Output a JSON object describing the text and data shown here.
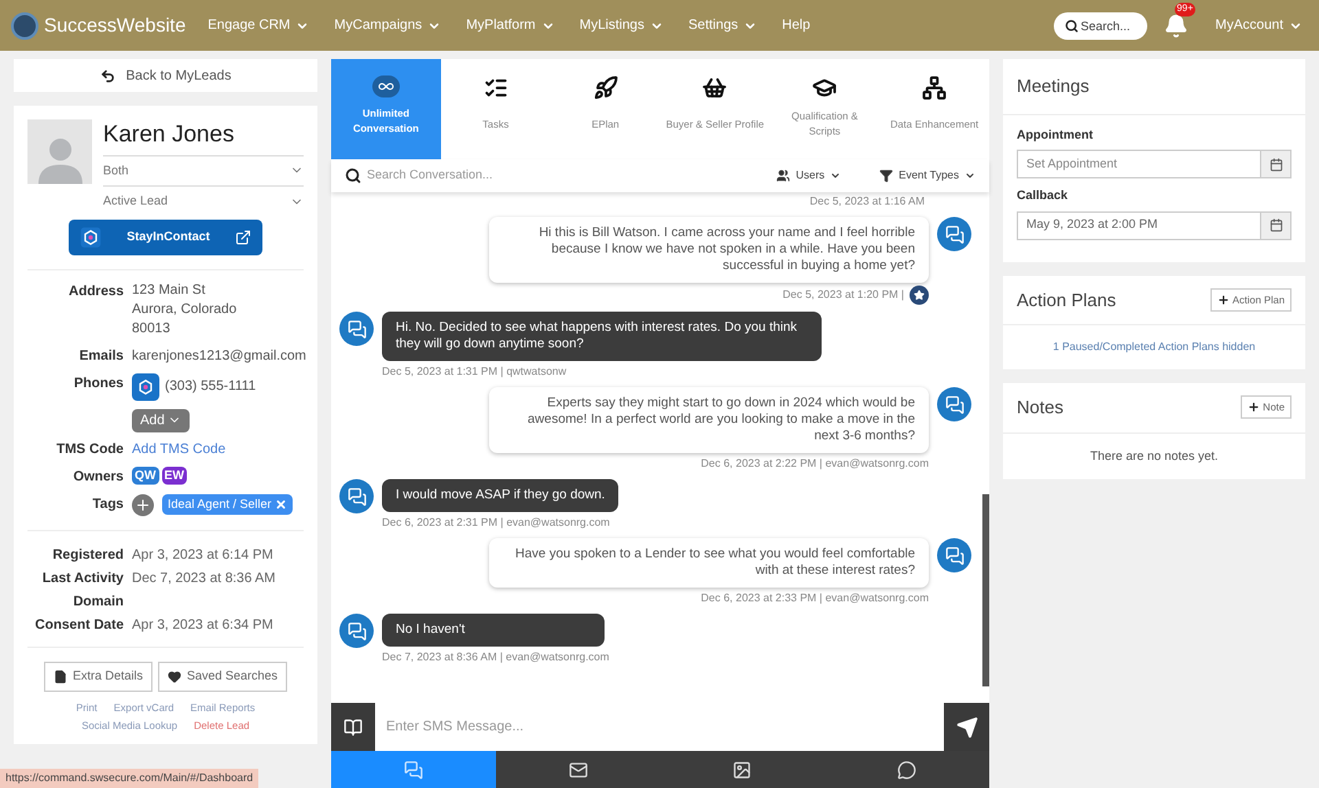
{
  "nav": {
    "brand": "SuccessWebsite",
    "items": [
      {
        "label": "Engage CRM",
        "dropdown": true
      },
      {
        "label": "MyCampaigns",
        "dropdown": true
      },
      {
        "label": "MyPlatform",
        "dropdown": true
      },
      {
        "label": "MyListings",
        "dropdown": true
      },
      {
        "label": "Settings",
        "dropdown": true
      },
      {
        "label": "Help",
        "dropdown": false
      }
    ],
    "search_placeholder": "Search...",
    "notifications_badge": "99+",
    "account": "MyAccount"
  },
  "back_link": "Back to MyLeads",
  "lead": {
    "name": "Karen Jones",
    "type": "Both",
    "status": "Active Lead",
    "stay_button": "StayInContact",
    "fields": [
      {
        "kind": "lines",
        "label": "Address",
        "lines": [
          "123 Main St",
          "Aurora, Colorado",
          "80013"
        ]
      },
      {
        "kind": "text",
        "label": "Emails",
        "value": "karenjones1213@gmail.com"
      },
      {
        "kind": "phone",
        "label": "Phones",
        "value": "(303) 555-1111",
        "add": "Add"
      },
      {
        "kind": "link",
        "label": "TMS Code",
        "value": "Add TMS Code"
      },
      {
        "kind": "owners",
        "label": "Owners",
        "owners": [
          {
            "initials": "QW",
            "color": "#2d7fd6"
          },
          {
            "initials": "EW",
            "color": "#7b2fd0"
          }
        ]
      },
      {
        "kind": "tags",
        "label": "Tags",
        "tags": [
          "Ideal Agent / Seller"
        ]
      }
    ],
    "dates": [
      {
        "label": "Registered",
        "value": "Apr 3, 2023 at 6:14 PM"
      },
      {
        "label": "Last Activity",
        "value": "Dec 7, 2023 at 8:36 AM"
      },
      {
        "label": "Domain"
      },
      {
        "label": "Consent Date",
        "value": "Apr 3, 2023 at 6:34 PM"
      }
    ],
    "buttons": [
      "Extra Details",
      "Saved Searches"
    ],
    "links": [
      {
        "label": "Print",
        "danger": false
      },
      {
        "label": "Export vCard",
        "danger": false
      },
      {
        "label": "Email Reports",
        "danger": false
      },
      {
        "label": "Social Media Lookup",
        "danger": false
      },
      {
        "label": "Delete Lead",
        "danger": true
      }
    ]
  },
  "tabs": [
    {
      "kind": "conversation",
      "label": "Unlimited Conversation",
      "selected": true
    },
    {
      "kind": "tasks",
      "label": "Tasks",
      "selected": false
    },
    {
      "kind": "eplan",
      "label": "EPlan",
      "selected": false
    },
    {
      "kind": "basket",
      "label": "Buyer & Seller Profile",
      "selected": false
    },
    {
      "kind": "cap",
      "label": "Qualification & Scripts",
      "selected": false
    },
    {
      "kind": "network",
      "label": "Data Enhancement",
      "selected": false
    }
  ],
  "conversation": {
    "search_placeholder": "Search Conversation...",
    "users_filter": "Users",
    "event_filter": "Event Types",
    "top_meta": "Dec 5, 2023 at 1:16 AM",
    "messages": [
      {
        "kind": "outgoing",
        "text": "Hi this is Bill Watson. I came across your name and I feel horrible because I know we have not spoken in a while. Have you been successful in buying a home yet?",
        "meta": "Dec 5, 2023 at 1:20 PM |",
        "starred": true
      },
      {
        "kind": "incoming",
        "text": "Hi. No. Decided to see what happens with interest rates. Do you think they will go down anytime soon?",
        "meta": "Dec 5, 2023 at 1:31 PM | qwtwatsonw",
        "starred": false
      },
      {
        "kind": "outgoing",
        "text": "Experts say they might start to go down in 2024 which would be awesome! In a perfect world are you looking to make a move in the next 3-6 months?",
        "meta": "Dec 6, 2023 at 2:22 PM | evan@watsonrg.com",
        "starred": false
      },
      {
        "kind": "incoming",
        "text": "I would move ASAP if they go down.",
        "meta": "Dec 6, 2023 at 2:31 PM | evan@watsonrg.com",
        "starred": false
      },
      {
        "kind": "outgoing",
        "text": "Have you spoken to a Lender to see what you would feel comfortable with at these interest rates?",
        "meta": "Dec 6, 2023 at 2:33 PM | evan@watsonrg.com",
        "starred": false
      },
      {
        "kind": "incoming",
        "text": "No I haven't",
        "meta": "Dec 7, 2023 at 8:36 AM | evan@watsonrg.com",
        "starred": false
      }
    ],
    "input_placeholder": "Enter SMS Message...",
    "channels": [
      {
        "kind": "sms",
        "selected": true
      },
      {
        "kind": "email",
        "selected": false
      },
      {
        "kind": "image",
        "selected": false
      },
      {
        "kind": "messenger",
        "selected": false
      }
    ]
  },
  "meetings": {
    "title": "Meetings",
    "fields": [
      {
        "label": "Appointment",
        "placeholder": "Set Appointment"
      },
      {
        "label": "Callback",
        "value": "May 9, 2023 at 2:00 PM"
      }
    ]
  },
  "action_plans": {
    "title": "Action Plans",
    "button": "Action Plan",
    "hidden_link": "1 Paused/Completed Action Plans hidden"
  },
  "notes": {
    "title": "Notes",
    "button": "Note",
    "empty": "There are no notes yet."
  },
  "status_url": "https://command.swsecure.com/Main/#/Dashboard"
}
